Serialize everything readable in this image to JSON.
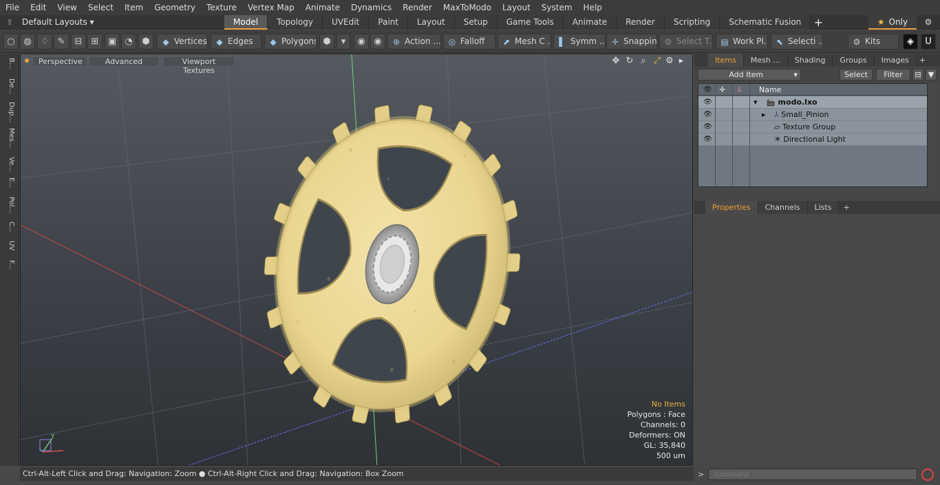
{
  "menubar": [
    "File",
    "Edit",
    "View",
    "Select",
    "Item",
    "Geometry",
    "Texture",
    "Vertex Map",
    "Animate",
    "Dynamics",
    "Render",
    "MaxToModo",
    "Layout",
    "System",
    "Help"
  ],
  "layout_select": "Default Layouts ▾",
  "tabs": [
    "Model",
    "Topology",
    "UVEdit",
    "Paint",
    "Layout",
    "Setup",
    "Game Tools",
    "Animate",
    "Render",
    "Scripting",
    "Schematic Fusion"
  ],
  "active_tab": "Model",
  "only_label": "Only",
  "toolbar": {
    "vertices": "Vertices",
    "edges": "Edges",
    "polygons": "Polygons",
    "action": "Action ...",
    "falloff": "Falloff",
    "mesh": "Mesh C ...",
    "symm": "Symm ...",
    "snapping": "Snapping",
    "select_t": "Select T...",
    "work_pl": "Work Pl...",
    "selecti": "Selecti ...",
    "kits": "Kits"
  },
  "left_tabs": [
    "B...",
    "De...",
    "Dup...",
    "Mes...",
    "Ve...",
    "E...",
    "Pol...",
    "C...",
    "UV",
    "F..."
  ],
  "viewport": {
    "perspective": "Perspective",
    "advanced": "Advanced",
    "viewport_textures": "Viewport Textures",
    "info": {
      "no_items": "No Items",
      "polygons": "Polygons : Face",
      "channels": "Channels: 0",
      "deformers": "Deformers: ON",
      "gl": "GL: 35,840",
      "scale": "500 um"
    },
    "axis_y": "Y"
  },
  "status": "Ctrl-Alt-Left Click and Drag: Navigation: Zoom ● Ctrl-Alt-Right Click and Drag: Navigation: Box Zoom",
  "right_panel": {
    "tabs": [
      "Items",
      "Mesh ...",
      "Shading",
      "Groups",
      "Images"
    ],
    "add_item": "Add Item",
    "select": "Select",
    "filter": "Filter",
    "name_header": "Name",
    "items": [
      {
        "name": "modo.lxo",
        "level": 0
      },
      {
        "name": "Small_Pinion",
        "level": 1
      },
      {
        "name": "Texture Group",
        "level": 1
      },
      {
        "name": "Directional Light",
        "level": 1
      }
    ],
    "props_tabs": [
      "Properties",
      "Channels",
      "Lists"
    ]
  },
  "command_placeholder": "Command"
}
